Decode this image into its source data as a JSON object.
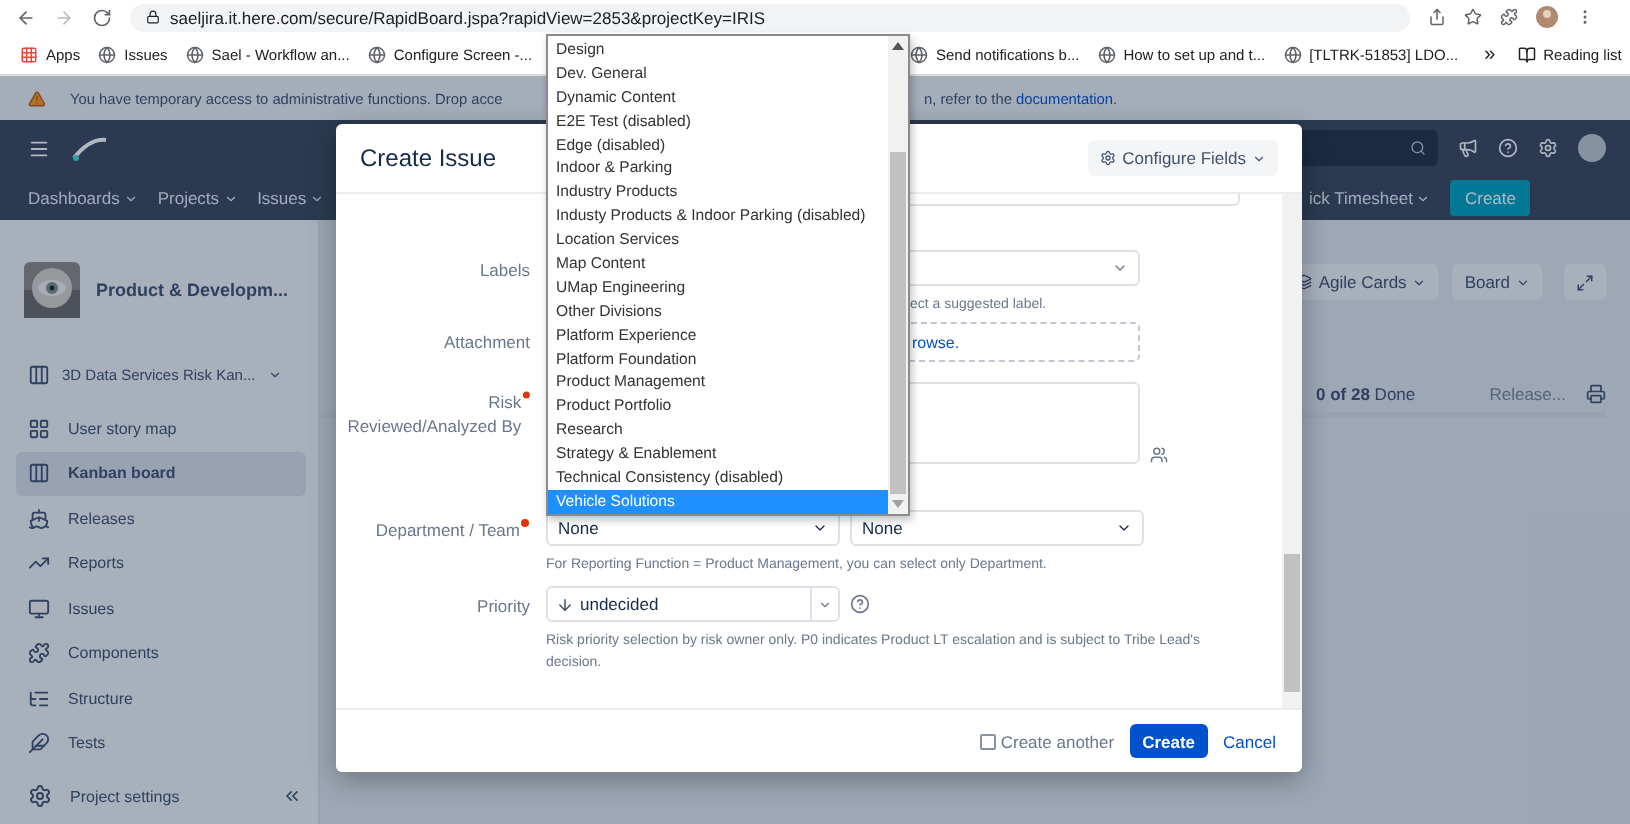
{
  "browser": {
    "url": "saeljira.it.here.com/secure/RapidBoard.jspa?rapidView=2853&projectKey=IRIS"
  },
  "bookmarks_left": [
    {
      "label": "Apps",
      "kind": "apps"
    },
    {
      "label": "Issues",
      "kind": "site"
    },
    {
      "label": "Sael - Workflow an...",
      "kind": "site"
    },
    {
      "label": "Configure Screen -...",
      "kind": "site"
    }
  ],
  "bookmarks_right": [
    {
      "label": "Send notifications b...",
      "kind": "site"
    },
    {
      "label": "How to set up and t...",
      "kind": "site"
    },
    {
      "label": "[TLTRK-51853] LDO...",
      "kind": "site"
    }
  ],
  "bookmarks_more": "»",
  "reading_list": "Reading list",
  "banner": {
    "text_start": "You have temporary access to administrative functions. Drop acce",
    "text_end": "n, refer to the ",
    "link": "documentation",
    "tail": "."
  },
  "header": {
    "nav": [
      {
        "label": "Dashboards"
      },
      {
        "label": "Projects"
      },
      {
        "label": "Issues"
      }
    ],
    "right_nav": "ick Timesheet",
    "create": "Create"
  },
  "sidebar": {
    "project": "Product & Developm...",
    "board": "3D Data Services Risk Kan...",
    "items": [
      {
        "label": "User story map",
        "kind": "storymap",
        "selected": false
      },
      {
        "label": "Kanban board",
        "kind": "kanban",
        "selected": true
      },
      {
        "label": "Releases",
        "kind": "releases",
        "selected": false
      },
      {
        "label": "Reports",
        "kind": "reports",
        "selected": false
      },
      {
        "label": "Issues",
        "kind": "issues",
        "selected": false
      },
      {
        "label": "Components",
        "kind": "components",
        "selected": false
      },
      {
        "label": "Structure",
        "kind": "structure",
        "selected": false
      },
      {
        "label": "Tests",
        "kind": "tests",
        "selected": false
      }
    ],
    "settings": "Project settings"
  },
  "board": {
    "toolbar": [
      "Agile Cards",
      "Board"
    ],
    "summary": "**0 of 28** Done",
    "release": "Release..."
  },
  "modal": {
    "title": "Create Issue",
    "configure": "Configure Fields",
    "fields": [
      {
        "kind": "select",
        "label": "Labels",
        "hint": "ect a suggested label."
      },
      {
        "kind": "attachment",
        "label": "Attachment",
        "link": "rowse."
      },
      {
        "kind": "textarea",
        "label": "Risk Reviewed/Analyzed By",
        "required": true
      },
      {
        "kind": "double_select",
        "label": "Department / Team",
        "required": true,
        "values": [
          "None",
          "None"
        ],
        "hint": "For Reporting Function = Product Management, you can select only Department."
      },
      {
        "kind": "priority",
        "label": "Priority",
        "value": "undecided",
        "hint": "Risk priority selection by risk owner only. P0 indicates Product LT escalation and is subject to Tribe Lead's decision."
      }
    ],
    "create_another": {
      "label": "Create another",
      "checked": false
    },
    "submit": "Create",
    "cancel": "Cancel"
  },
  "dropdown": {
    "options": [
      {
        "label": "Design",
        "selected": false
      },
      {
        "label": "Dev. General",
        "selected": false
      },
      {
        "label": "Dynamic Content",
        "selected": false
      },
      {
        "label": "E2E Test (disabled)",
        "selected": false
      },
      {
        "label": "Edge (disabled)",
        "selected": false
      },
      {
        "label": "Indoor & Parking",
        "selected": false
      },
      {
        "label": "Industry Products",
        "selected": false
      },
      {
        "label": "Industy Products & Indoor Parking (disabled)",
        "selected": false
      },
      {
        "label": "Location Services",
        "selected": false
      },
      {
        "label": "Map Content",
        "selected": false
      },
      {
        "label": "UMap Engineering",
        "selected": false
      },
      {
        "label": "Other Divisions",
        "selected": false
      },
      {
        "label": "Platform Experience",
        "selected": false
      },
      {
        "label": "Platform Foundation",
        "selected": false
      },
      {
        "label": "Product Management",
        "selected": false
      },
      {
        "label": "Product Portfolio",
        "selected": false
      },
      {
        "label": "Research",
        "selected": false
      },
      {
        "label": "Strategy & Enablement",
        "selected": false
      },
      {
        "label": "Technical Consistency (disabled)",
        "selected": false
      },
      {
        "label": "Vehicle Solutions",
        "selected": true
      }
    ]
  }
}
